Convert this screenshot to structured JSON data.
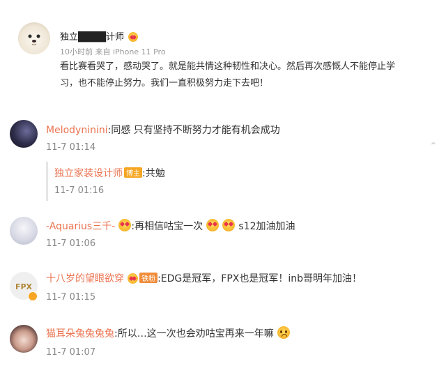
{
  "post": {
    "author": "独立████计师",
    "meta": "10小时前  来自 iPhone 11 Pro",
    "text_line1": "看比赛看哭了，感动哭了。就是能共情这种韧性和决心。然后再次感慨人不能停止学",
    "text_line2": "习，也不能停止努力。我们一直积极努力走下去吧！"
  },
  "comments": [
    {
      "name": "Melodyninini",
      "text": ":同感 只有坚持不断努力才能有机会成功",
      "time": "11-7 01:14",
      "reply": {
        "name": "独立家装设计师",
        "badge": "博主",
        "text": ":共勉",
        "time": "11-7 01:16"
      }
    },
    {
      "name": "-Aquarius三千-",
      "text_part1": ":再相信咕宝一次",
      "text_part2": "s12加油加油",
      "time": "11-7 01:06"
    },
    {
      "name": "十八岁的望眼欲穿",
      "badge": "铁粉",
      "text": ":EDG是冠军，FPX也是冠军！inb哥明年加油！",
      "time": "11-7 01:15"
    },
    {
      "name": "猫耳朵兔兔兔兔",
      "text": ":所以…这一次也会劝咕宝再来一年嘛",
      "time": "11-7 01:07"
    }
  ],
  "icons": {
    "post_author_badge": "heart-emoji-icon",
    "love_emoji": "heart-eyes-emoji-icon",
    "pleading_emoji": "pleading-face-emoji-icon",
    "fan_badge": "iron-fan-badge-icon",
    "verified": "verified-badge-icon",
    "scroll_hint": "scroll-indicator-icon"
  },
  "colors": {
    "username": "#eb7350",
    "blogger_badge": "#f5a623",
    "fan_badge": "#f08c3a"
  },
  "ui": {
    "scroll_mark": "⌃"
  }
}
